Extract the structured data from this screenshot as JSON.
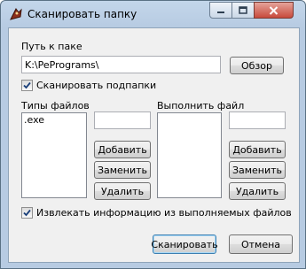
{
  "window": {
    "title": "Сканировать папку"
  },
  "path": {
    "label": "Путь к паке",
    "value": "K:\\PePrograms\\",
    "browse_label": "Обзор"
  },
  "scan_subfolders": {
    "label": "Сканировать подпапки",
    "checked": true
  },
  "file_types": {
    "label": "Типы файлов",
    "items": [
      ".exe"
    ],
    "input_value": "",
    "add_label": "Добавить",
    "replace_label": "Заменить",
    "delete_label": "Удалить"
  },
  "execute_file": {
    "label": "Выполнить файл",
    "items": [],
    "input_value": "",
    "add_label": "Добавить",
    "replace_label": "Заменить",
    "delete_label": "Удалить"
  },
  "extract_info": {
    "label": "Извлекать информацию из выполняемых файлов",
    "checked": true
  },
  "footer": {
    "scan_label": "Сканировать",
    "cancel_label": "Отмена"
  },
  "colors": {
    "title_bar": "#b9cde3",
    "close_button": "#c84a3c",
    "default_button_border": "#3c7fb1"
  }
}
